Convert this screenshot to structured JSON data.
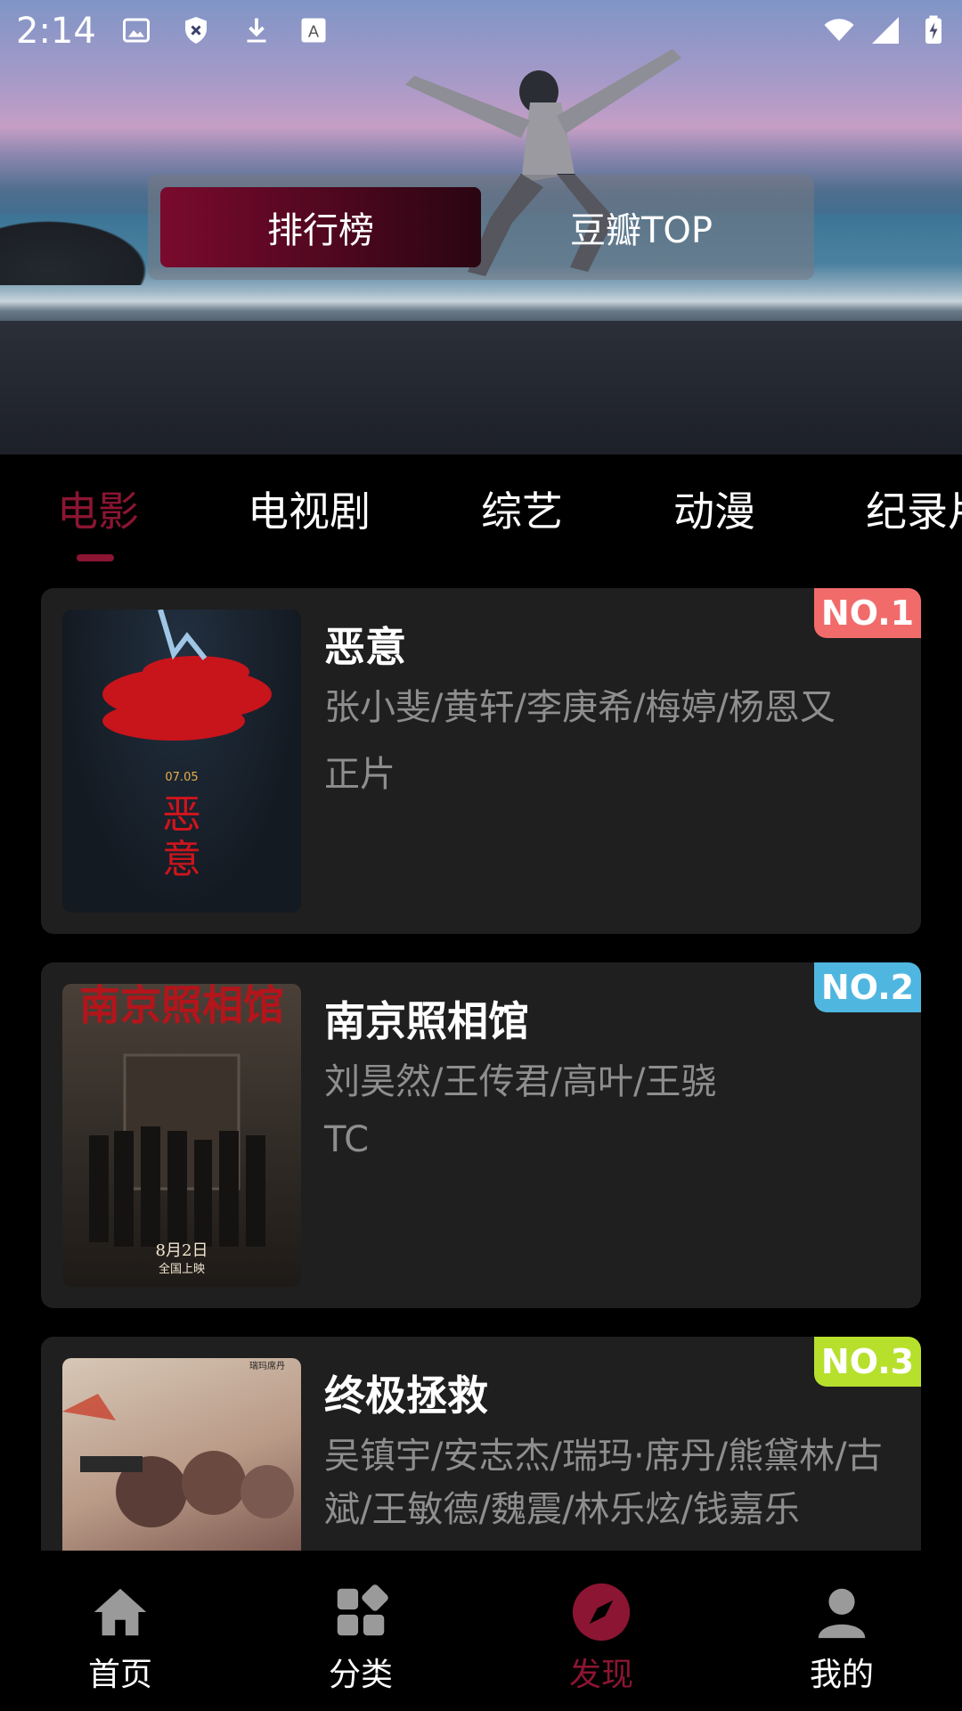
{
  "status_bar": {
    "time": "2:14"
  },
  "hero": {
    "segments": [
      {
        "label": "排行榜",
        "active": true
      },
      {
        "label": "豆瓣TOP",
        "active": false
      }
    ]
  },
  "category_tabs": [
    {
      "label": "电影",
      "active": true
    },
    {
      "label": "电视剧",
      "active": false
    },
    {
      "label": "综艺",
      "active": false
    },
    {
      "label": "动漫",
      "active": false
    },
    {
      "label": "纪录片",
      "active": false
    }
  ],
  "list": [
    {
      "rank": "NO.1",
      "rank_color": "#f26b6b",
      "title": "恶意",
      "cast": "张小斐/黄轩/李庚希/梅婷/杨恩又",
      "quality": "正片",
      "poster": {
        "date": "07.05",
        "big_text": "恶意"
      }
    },
    {
      "rank": "NO.2",
      "rank_color": "#4fb6e0",
      "title": "南京照相馆",
      "cast": "刘昊然/王传君/高叶/王骁",
      "quality": "TC",
      "poster": {
        "headline": "南京照相馆",
        "release": "8月2日",
        "release_sub": "全国上映"
      }
    },
    {
      "rank": "NO.3",
      "rank_color": "#b7e02c",
      "title": "终极拯救",
      "cast": "吴镇宇/安志杰/瑞玛·席丹/熊黛林/古斌/王敏德/魏震/林乐炫/钱嘉乐",
      "quality": "",
      "poster": {
        "corner": "瑞玛席丹"
      }
    }
  ],
  "bottom_nav": [
    {
      "label": "首页",
      "icon": "home-icon",
      "active": false
    },
    {
      "label": "分类",
      "icon": "category-icon",
      "active": false
    },
    {
      "label": "发现",
      "icon": "compass-icon",
      "active": true
    },
    {
      "label": "我的",
      "icon": "person-icon",
      "active": false
    }
  ],
  "colors": {
    "accent": "#8b1532",
    "card_bg": "#1f1f1f",
    "muted_text": "#8e8e8e"
  }
}
